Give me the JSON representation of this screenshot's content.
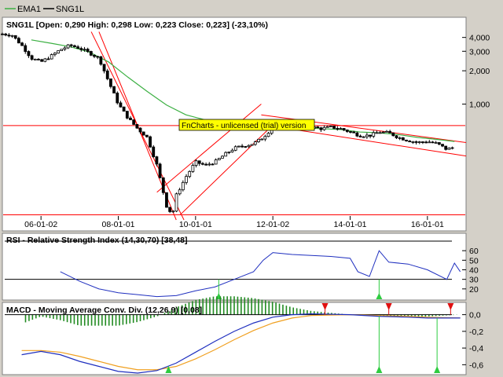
{
  "legend": {
    "items": [
      {
        "label": "EMA1",
        "color": "#3cb043"
      },
      {
        "label": "SNG1L",
        "color": "#000000"
      }
    ]
  },
  "watermark": "FnCharts - unlicensed (trial) version",
  "colors": {
    "background": "#d4d0c8",
    "panel": "#ffffff",
    "price": "#000000",
    "ema": "#3cb043",
    "trendline": "#ff0000",
    "rsi": "#1f2fbf",
    "macd": "#1f2fbf",
    "signal": "#f0a020",
    "histogram": "#228b22",
    "buy_marker": "#2ecc40",
    "sell_marker": "#e01010"
  },
  "chart_data": [
    {
      "type": "candlestick",
      "title": "SNG1L [Open: 0,290  High: 0,298  Low: 0,223  Close: 0,223] (-23,10%)",
      "y_scale": "log",
      "ylim": [
        0.09,
        5.0
      ],
      "y_ticks": [
        {
          "value": 4.0,
          "label": "4,000"
        },
        {
          "value": 3.0,
          "label": "3,000"
        },
        {
          "value": 2.0,
          "label": "2,000"
        },
        {
          "value": 1.0,
          "label": "1,000"
        }
      ],
      "x_ticks": [
        "06-01-02",
        "08-01-01",
        "10-01-01",
        "12-01-02",
        "14-01-01",
        "16-01-01"
      ],
      "price_path": [
        [
          2005.0,
          4.3
        ],
        [
          2005.25,
          4.2
        ],
        [
          2005.5,
          3.4
        ],
        [
          2005.75,
          2.6
        ],
        [
          2006.0,
          2.4
        ],
        [
          2006.25,
          2.7
        ],
        [
          2006.5,
          3.1
        ],
        [
          2006.75,
          3.4
        ],
        [
          2007.0,
          3.2
        ],
        [
          2007.25,
          2.9
        ],
        [
          2007.5,
          2.6
        ],
        [
          2007.75,
          1.6
        ],
        [
          2008.0,
          1.0
        ],
        [
          2008.25,
          0.75
        ],
        [
          2008.5,
          0.6
        ],
        [
          2008.75,
          0.5
        ],
        [
          2009.0,
          0.28
        ],
        [
          2009.25,
          0.12
        ],
        [
          2009.4,
          0.1
        ],
        [
          2009.5,
          0.15
        ],
        [
          2009.75,
          0.22
        ],
        [
          2010.0,
          0.3
        ],
        [
          2010.25,
          0.28
        ],
        [
          2010.5,
          0.3
        ],
        [
          2010.75,
          0.35
        ],
        [
          2011.0,
          0.4
        ],
        [
          2011.25,
          0.42
        ],
        [
          2011.5,
          0.44
        ],
        [
          2011.75,
          0.5
        ],
        [
          2012.0,
          0.62
        ],
        [
          2012.25,
          0.64
        ],
        [
          2012.5,
          0.66
        ],
        [
          2012.75,
          0.64
        ],
        [
          2013.0,
          0.62
        ],
        [
          2013.25,
          0.6
        ],
        [
          2013.5,
          0.62
        ],
        [
          2013.75,
          0.6
        ],
        [
          2014.0,
          0.56
        ],
        [
          2014.25,
          0.52
        ],
        [
          2014.5,
          0.52
        ],
        [
          2014.75,
          0.56
        ],
        [
          2015.0,
          0.55
        ],
        [
          2015.25,
          0.5
        ],
        [
          2015.5,
          0.47
        ],
        [
          2015.75,
          0.45
        ],
        [
          2016.0,
          0.46
        ],
        [
          2016.25,
          0.44
        ],
        [
          2016.5,
          0.39
        ],
        [
          2016.7,
          0.41
        ]
      ],
      "ema_series": [
        [
          2005.75,
          3.8
        ],
        [
          2006.25,
          3.55
        ],
        [
          2006.75,
          3.3
        ],
        [
          2007.25,
          2.95
        ],
        [
          2007.75,
          2.4
        ],
        [
          2008.25,
          1.75
        ],
        [
          2008.75,
          1.3
        ],
        [
          2009.25,
          0.98
        ],
        [
          2009.75,
          0.8
        ],
        [
          2010.25,
          0.72
        ],
        [
          2010.75,
          0.66
        ],
        [
          2011.25,
          0.62
        ],
        [
          2011.75,
          0.6
        ],
        [
          2012.25,
          0.6
        ],
        [
          2012.75,
          0.61
        ],
        [
          2013.25,
          0.6
        ],
        [
          2013.75,
          0.59
        ],
        [
          2014.25,
          0.56
        ],
        [
          2014.75,
          0.55
        ],
        [
          2015.25,
          0.53
        ],
        [
          2015.75,
          0.5
        ],
        [
          2016.25,
          0.48
        ],
        [
          2016.7,
          0.46
        ]
      ],
      "horizontal_lines": [
        0.64,
        0.1
      ],
      "trend_lines": [
        {
          "from": [
            2007.5,
            4.5
          ],
          "to": [
            2009.5,
            0.09
          ]
        },
        {
          "from": [
            2007.3,
            4.5
          ],
          "to": [
            2009.7,
            0.09
          ]
        },
        {
          "from": [
            2009.0,
            0.16
          ],
          "to": [
            2011.7,
            1.0
          ]
        },
        {
          "from": [
            2009.6,
            0.1
          ],
          "to": [
            2012.1,
            0.7
          ]
        },
        {
          "from": [
            2011.7,
            0.8
          ],
          "to": [
            2017.0,
            0.45
          ]
        },
        {
          "from": [
            2012.4,
            0.6
          ],
          "to": [
            2017.0,
            0.34
          ]
        }
      ]
    },
    {
      "type": "line",
      "title": "RSI - Relative Strength Index (14,30,70) [38,48]",
      "ylim": [
        10,
        70
      ],
      "y_ticks": [
        20,
        30,
        40,
        50,
        60
      ],
      "reference_lines": [
        30,
        70
      ],
      "series": [
        [
          2006.5,
          38
        ],
        [
          2007.0,
          28
        ],
        [
          2007.5,
          20
        ],
        [
          2008.0,
          16
        ],
        [
          2008.5,
          14
        ],
        [
          2009.0,
          12
        ],
        [
          2009.5,
          13
        ],
        [
          2010.0,
          18
        ],
        [
          2010.5,
          22
        ],
        [
          2011.0,
          30
        ],
        [
          2011.5,
          38
        ],
        [
          2011.75,
          50
        ],
        [
          2012.0,
          58
        ],
        [
          2012.5,
          56
        ],
        [
          2013.0,
          55
        ],
        [
          2013.5,
          54
        ],
        [
          2014.0,
          52
        ],
        [
          2014.2,
          38
        ],
        [
          2014.5,
          33
        ],
        [
          2014.75,
          60
        ],
        [
          2015.0,
          48
        ],
        [
          2015.5,
          46
        ],
        [
          2016.0,
          40
        ],
        [
          2016.5,
          30
        ],
        [
          2016.7,
          47
        ],
        [
          2016.85,
          38
        ]
      ],
      "buy_markers": [
        2010.6,
        2014.75
      ]
    },
    {
      "type": "line",
      "title": "MACD - Moving Average Conv. Div. (12,26,9) [0,08]",
      "ylim": [
        -0.7,
        0.1
      ],
      "y_ticks": [
        {
          "value": 0.0,
          "label": "0,0"
        },
        {
          "value": -0.2,
          "label": "-0,2"
        },
        {
          "value": -0.4,
          "label": "-0,4"
        },
        {
          "value": -0.6,
          "label": "-0,6"
        }
      ],
      "macd_series": [
        [
          2005.5,
          -0.48
        ],
        [
          2006.0,
          -0.44
        ],
        [
          2006.5,
          -0.48
        ],
        [
          2007.0,
          -0.56
        ],
        [
          2007.5,
          -0.62
        ],
        [
          2008.0,
          -0.68
        ],
        [
          2008.5,
          -0.7
        ],
        [
          2009.0,
          -0.67
        ],
        [
          2009.5,
          -0.58
        ],
        [
          2010.0,
          -0.45
        ],
        [
          2010.5,
          -0.32
        ],
        [
          2011.0,
          -0.2
        ],
        [
          2011.5,
          -0.1
        ],
        [
          2012.0,
          -0.03
        ],
        [
          2012.5,
          0.0
        ],
        [
          2013.0,
          0.01
        ],
        [
          2014.0,
          0.0
        ],
        [
          2014.75,
          -0.02
        ],
        [
          2015.5,
          -0.03
        ],
        [
          2016.0,
          -0.04
        ],
        [
          2016.85,
          -0.04
        ]
      ],
      "signal_series": [
        [
          2005.5,
          -0.43
        ],
        [
          2006.0,
          -0.43
        ],
        [
          2006.5,
          -0.45
        ],
        [
          2007.0,
          -0.5
        ],
        [
          2007.5,
          -0.56
        ],
        [
          2008.0,
          -0.62
        ],
        [
          2008.5,
          -0.66
        ],
        [
          2009.0,
          -0.66
        ],
        [
          2009.5,
          -0.62
        ],
        [
          2010.0,
          -0.53
        ],
        [
          2010.5,
          -0.42
        ],
        [
          2011.0,
          -0.3
        ],
        [
          2011.5,
          -0.19
        ],
        [
          2012.0,
          -0.1
        ],
        [
          2012.5,
          -0.04
        ],
        [
          2013.0,
          -0.01
        ],
        [
          2014.0,
          0.0
        ],
        [
          2014.75,
          -0.01
        ],
        [
          2015.5,
          -0.02
        ],
        [
          2016.0,
          -0.03
        ],
        [
          2016.85,
          -0.04
        ]
      ],
      "buy_markers": [
        2009.3,
        2014.75,
        2016.25
      ],
      "sell_markers": [
        2013.35,
        2015.0,
        2016.6
      ]
    }
  ]
}
